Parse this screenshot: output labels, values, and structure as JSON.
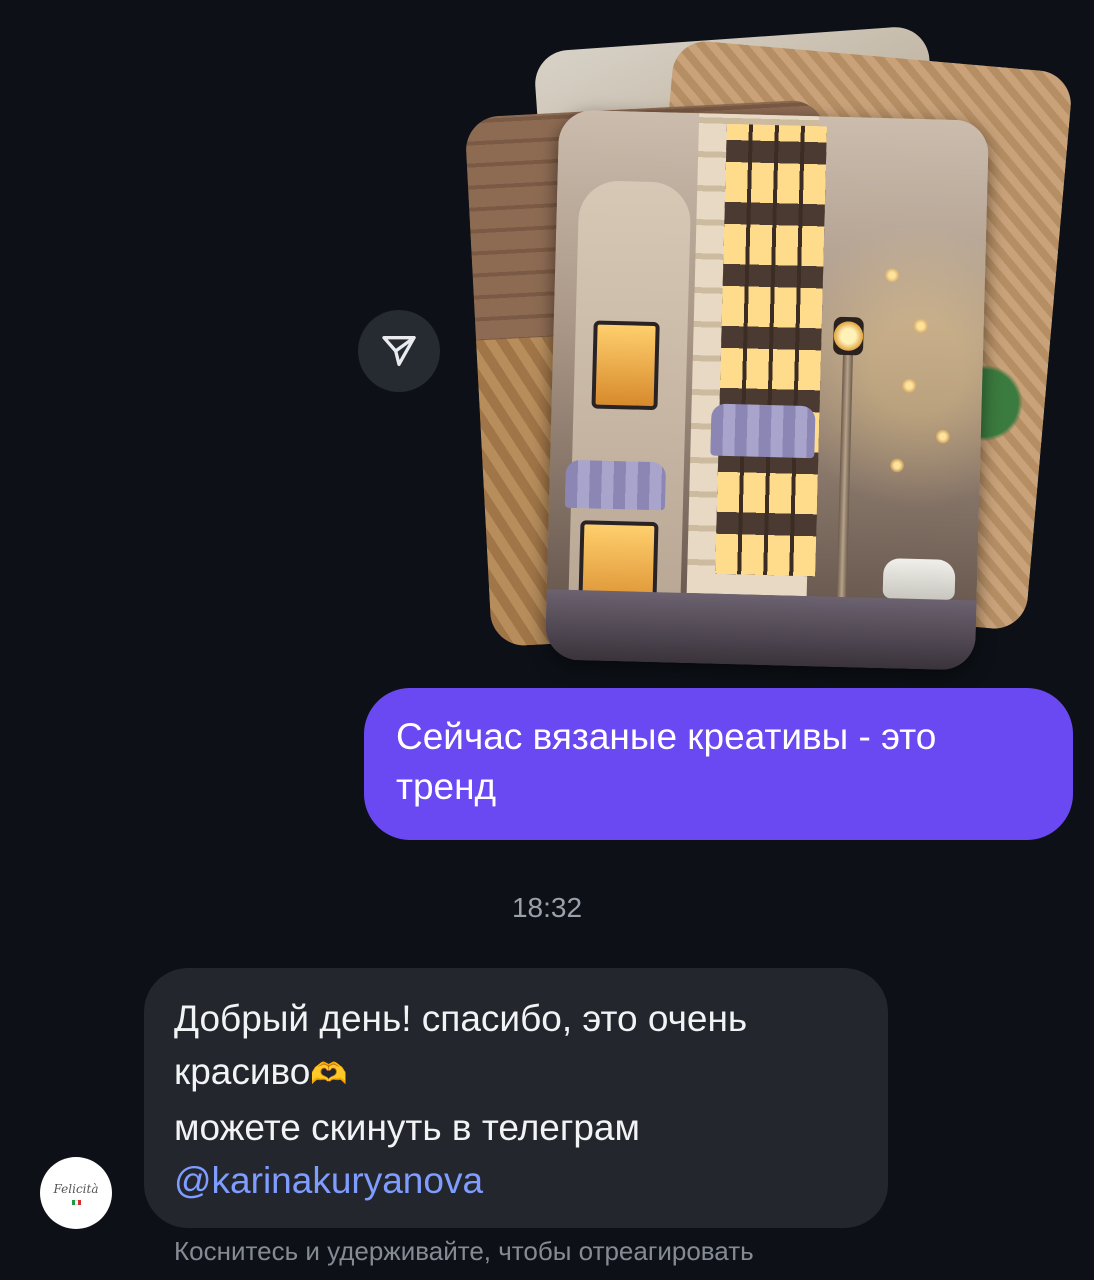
{
  "thread": {
    "outgoing_message": {
      "line1": "Сейчас вязаные креативы - это",
      "line2": "тренд",
      "bubble_color": "#6b49f2"
    },
    "timestamp": "18:32",
    "incoming_message": {
      "line1": "Добрый день! спасибо, это очень",
      "line2_text": "красиво",
      "line2_emoji": "🫶",
      "line3": "можете скинуть в телеграм",
      "mention": "@karinakuryanova",
      "mention_color": "#7f9cff"
    },
    "avatar": {
      "name_script": "Felicità"
    },
    "hint": "Коснитесь и удерживайте, чтобы отреагировать"
  },
  "icons": {
    "share": "send-paper-plane-icon"
  },
  "colors": {
    "background": "#0d1117",
    "incoming_bubble": "#23262c"
  }
}
